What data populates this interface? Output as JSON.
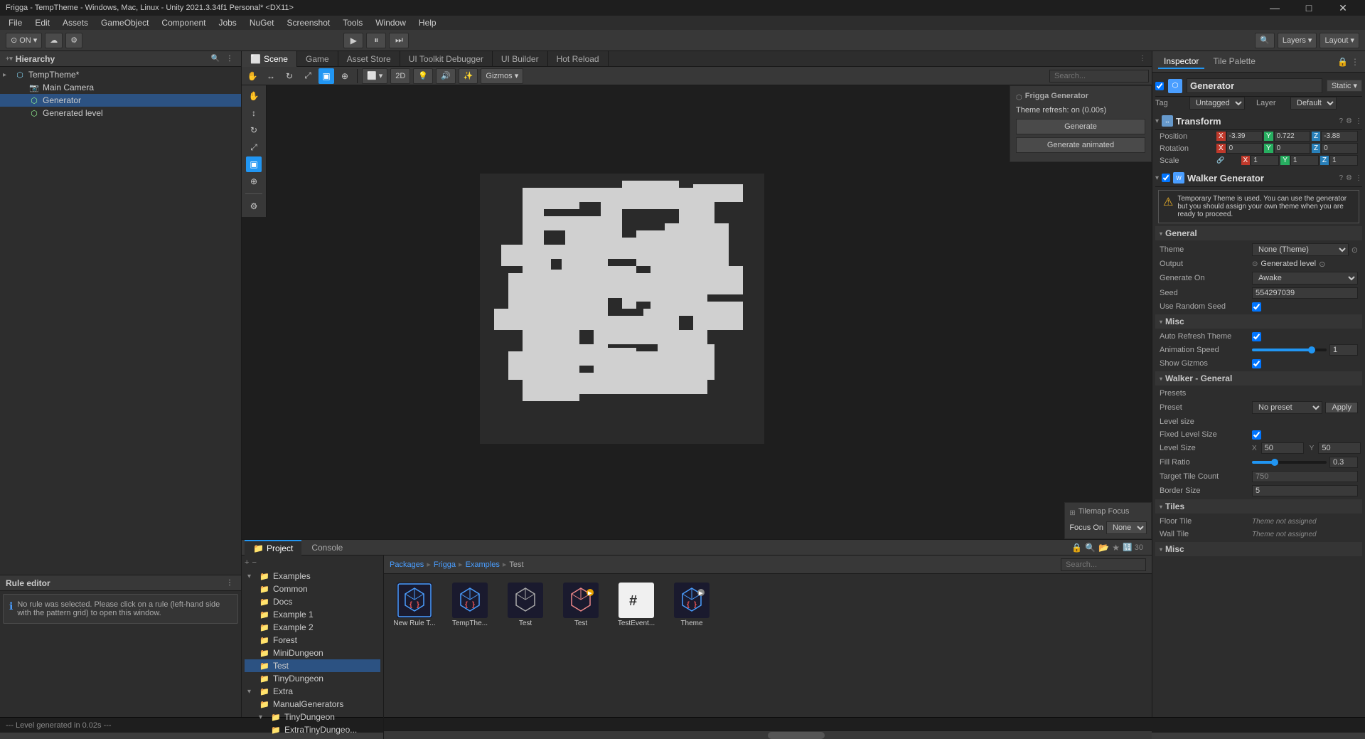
{
  "titlebar": {
    "title": "Frigga - TempTheme - Windows, Mac, Linux - Unity 2021.3.34f1 Personal* <DX11>",
    "minimize": "—",
    "maximize": "□",
    "close": "✕"
  },
  "menubar": {
    "items": [
      "File",
      "Edit",
      "Assets",
      "GameObject",
      "Component",
      "Jobs",
      "NuGet",
      "Screenshot",
      "Tools",
      "Window",
      "Help"
    ]
  },
  "toolbar": {
    "account_icon": "⊙",
    "on_label": "ON",
    "cloud_icon": "☁",
    "settings_icon": "⚙",
    "play_icon": "▶",
    "pause_icon": "⏸",
    "step_icon": "⏭",
    "layers_label": "Layers",
    "layout_label": "Layout"
  },
  "hierarchy": {
    "title": "Hierarchy",
    "items": [
      {
        "label": "TempTheme*",
        "indent": 0,
        "type": "scene",
        "expanded": true
      },
      {
        "label": "Main Camera",
        "indent": 1,
        "type": "camera"
      },
      {
        "label": "Generator",
        "indent": 1,
        "type": "generator",
        "selected": true
      },
      {
        "label": "Generated level",
        "indent": 1,
        "type": "object"
      }
    ]
  },
  "scene_tabs": [
    {
      "label": "Scene",
      "icon": "⬜",
      "active": true
    },
    {
      "label": "Game",
      "icon": "🎮",
      "active": false
    },
    {
      "label": "Asset Store",
      "icon": "🏪",
      "active": false
    },
    {
      "label": "UI Toolkit Debugger",
      "icon": "🔧",
      "active": false
    },
    {
      "label": "UI Builder",
      "icon": "⚙",
      "active": false
    },
    {
      "label": "Hot Reload",
      "icon": "🔥",
      "active": false
    }
  ],
  "scene_tools": {
    "mode_2d": "2D",
    "tools": [
      "✋",
      "↔",
      "↻",
      "⤢",
      "⊕",
      "⚙"
    ]
  },
  "frigga_generator": {
    "title": "Frigga Generator",
    "subtitle": "Theme refresh: on (0.00s)",
    "btn_generate": "Generate",
    "btn_animated": "Generate animated"
  },
  "tilemap_focus": {
    "title": "Tilemap Focus",
    "focus_label": "Focus On",
    "focus_value": "None",
    "icon": "⊞"
  },
  "rule_editor": {
    "title": "Rule editor",
    "info_text": "No rule was selected. Please click on a rule (left-hand side with the pattern grid) to open this window."
  },
  "inspector": {
    "title": "Inspector",
    "tile_palette": "Tile Palette",
    "gameobject_name": "Generator",
    "static_label": "Static",
    "tag": "Untagged",
    "layer": "Default",
    "transform": {
      "title": "Transform",
      "position": {
        "x": "-3.39",
        "y": "0.722",
        "z": "-3.88"
      },
      "rotation": {
        "x": "0",
        "y": "0",
        "z": "0"
      },
      "scale": {
        "x": "1",
        "y": "1",
        "z": "1"
      }
    },
    "walker_generator": {
      "title": "Walker Generator",
      "warning": "Temporary Theme is used. You can use the generator but you should assign your own theme when you are ready to proceed.",
      "general_section": "General",
      "theme_label": "Theme",
      "theme_value": "None (Theme)",
      "output_label": "Output",
      "output_value": "Generated level",
      "generate_on_label": "Generate On",
      "generate_on_value": "Awake",
      "seed_label": "Seed",
      "seed_value": "554297039",
      "use_random_seed_label": "Use Random Seed",
      "use_random_seed": true,
      "misc_section": "Misc",
      "auto_refresh_label": "Auto Refresh Theme",
      "auto_refresh": true,
      "animation_speed_label": "Animation Speed",
      "animation_speed": "1",
      "show_gizmos_label": "Show Gizmos",
      "show_gizmos": true,
      "walker_general_section": "Walker - General",
      "presets_section": "Presets",
      "preset_label": "Preset",
      "preset_value": "No preset",
      "apply_label": "Apply",
      "level_size_section": "Level size",
      "fixed_level_size_label": "Fixed Level Size",
      "fixed_level_size": true,
      "level_size_label": "Level Size",
      "level_size_x": "50",
      "level_size_y": "50",
      "fill_ratio_label": "Fill Ratio",
      "fill_ratio": "0.3",
      "target_tile_label": "Target Tile Count",
      "target_tile_value": "750",
      "border_size_label": "Border Size",
      "border_size": "5",
      "tiles_section": "Tiles",
      "floor_tile_label": "Floor Tile",
      "floor_tile_value": "Theme not assigned",
      "wall_tile_label": "Wall Tile",
      "wall_tile_value": "Theme not assigned",
      "misc2_section": "Misc"
    }
  },
  "project": {
    "title": "Project",
    "console_title": "Console",
    "breadcrumb": [
      "Packages",
      "Frigga",
      "Examples",
      "Test"
    ],
    "tree": [
      {
        "label": "Examples",
        "indent": 0,
        "expanded": true
      },
      {
        "label": "Common",
        "indent": 1
      },
      {
        "label": "Docs",
        "indent": 1
      },
      {
        "label": "Example 1",
        "indent": 1
      },
      {
        "label": "Example 2",
        "indent": 1
      },
      {
        "label": "Forest",
        "indent": 1
      },
      {
        "label": "MiniDungeon",
        "indent": 1
      },
      {
        "label": "Test",
        "indent": 1,
        "selected": true
      },
      {
        "label": "TinyDungeon",
        "indent": 1
      },
      {
        "label": "Extra",
        "indent": 0,
        "expanded": true
      },
      {
        "label": "ManualGenerators",
        "indent": 1
      },
      {
        "label": "TinyDungeon",
        "indent": 1,
        "expanded": true
      },
      {
        "label": "ExtraTinyDungeo...",
        "indent": 2
      }
    ],
    "grid_items": [
      {
        "label": "New Rule T...",
        "type": "rule"
      },
      {
        "label": "TempThe...",
        "type": "theme"
      },
      {
        "label": "Test",
        "type": "unity"
      },
      {
        "label": "Test",
        "type": "prefab"
      },
      {
        "label": "TestEvent...",
        "type": "text"
      },
      {
        "label": "Theme",
        "type": "theme2"
      }
    ]
  },
  "statusbar": {
    "message": "--- Level generated in 0.02s ---"
  }
}
